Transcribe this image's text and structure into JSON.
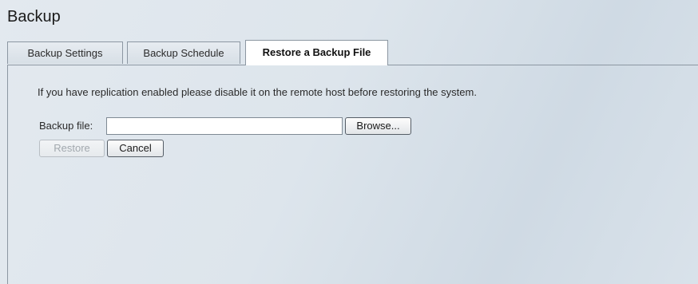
{
  "page": {
    "title": "Backup"
  },
  "tabs": [
    {
      "label": "Backup Settings",
      "active": false
    },
    {
      "label": "Backup Schedule",
      "active": false
    },
    {
      "label": "Restore a Backup File",
      "active": true
    }
  ],
  "restore": {
    "notice": "If you have replication enabled please disable it on the remote host before restoring the system.",
    "file_label": "Backup file:",
    "file_value": "",
    "browse_label": "Browse...",
    "restore_label": "Restore",
    "restore_enabled": false,
    "cancel_label": "Cancel"
  },
  "colors": {
    "background": "#dde5ec",
    "tab_border": "#8c97a2",
    "active_tab": "#ffffff",
    "disabled_text": "#a2a8ae"
  }
}
